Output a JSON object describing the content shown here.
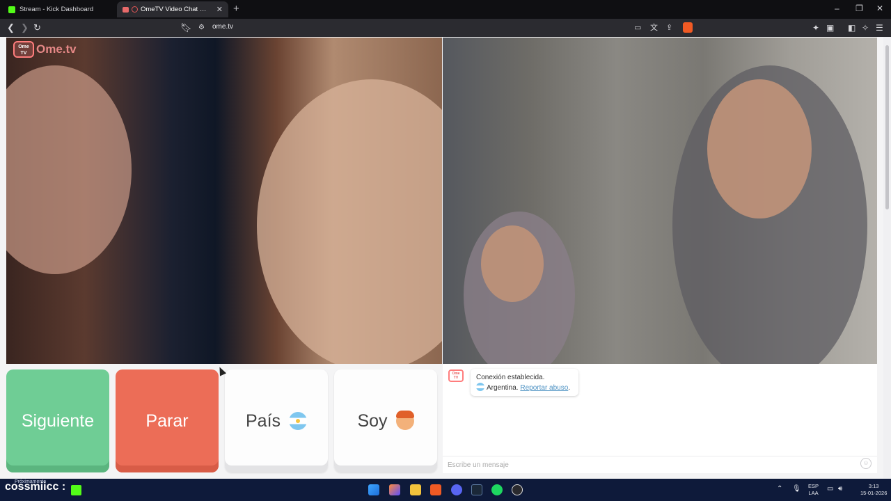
{
  "browser": {
    "tabs": [
      {
        "title": "Stream - Kick Dashboard",
        "active": false,
        "favicon": "kick-icon"
      },
      {
        "title": "OmeTV Video Chat — Omegle",
        "active": true,
        "favicon": "ometv-icon"
      }
    ],
    "new_tab": "+",
    "url": "ome.tv",
    "window_controls": {
      "minimize": "–",
      "maximize": "❐",
      "close": "✕"
    }
  },
  "page": {
    "logo_text": "Ome.tv",
    "logo_badge": "Ome TV",
    "buttons": {
      "siguiente": "Siguiente",
      "parar": "Parar",
      "pais": "País",
      "soy": "Soy"
    },
    "chat": {
      "badge": "Ome TV",
      "line1": "Conexión establecida.",
      "country": "Argentina.",
      "report_link": "Reportar abuso",
      "report_suffix": ".",
      "placeholder": "Escribe un mensaje"
    }
  },
  "taskbar": {
    "stream_text": "cossmiicc",
    "stream_colon": ":",
    "stream_sub": "Próximamente",
    "ime_line1": "ESP",
    "ime_line2": "LAA",
    "time": "3:13",
    "date": "15-01-2026"
  },
  "colors": {
    "siguiente": "#6fcd95",
    "parar": "#ec6d57",
    "brand": "#ff7d7d",
    "link": "#4a90c2"
  }
}
